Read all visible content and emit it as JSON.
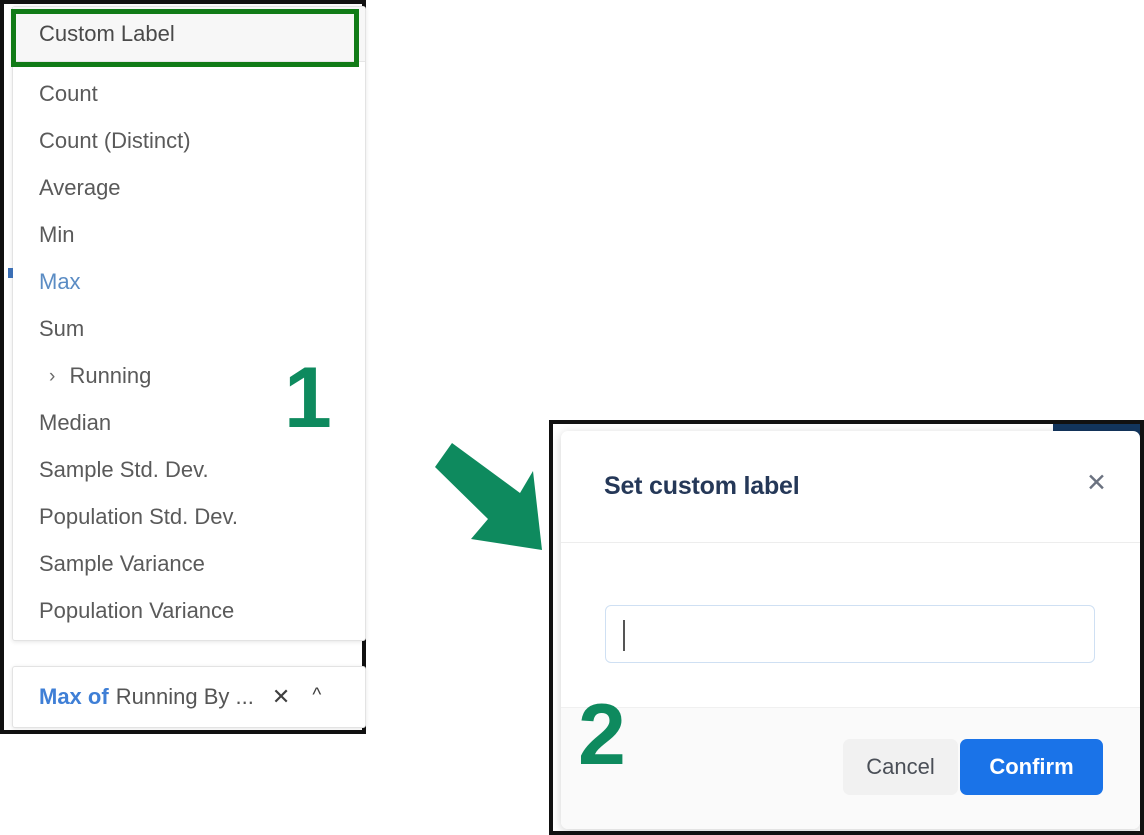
{
  "annotations": {
    "step_one": "1",
    "step_two": "2",
    "arrow_icon": "arrow-down-right-icon",
    "highlight_color": "#117b17",
    "annotation_color": "#0e8a5e"
  },
  "aggregation_menu": {
    "custom_label_row": "Custom Label",
    "items": [
      {
        "label": "Count",
        "selected": false,
        "sub": false
      },
      {
        "label": "Count (Distinct)",
        "selected": false,
        "sub": false
      },
      {
        "label": "Average",
        "selected": false,
        "sub": false
      },
      {
        "label": "Min",
        "selected": false,
        "sub": false
      },
      {
        "label": "Max",
        "selected": true,
        "sub": false
      },
      {
        "label": "Sum",
        "selected": false,
        "sub": false
      },
      {
        "label": "Running",
        "selected": false,
        "sub": true
      },
      {
        "label": "Median",
        "selected": false,
        "sub": false
      },
      {
        "label": "Sample Std. Dev.",
        "selected": false,
        "sub": false
      },
      {
        "label": "Population Std. Dev.",
        "selected": false,
        "sub": false
      },
      {
        "label": "Sample Variance",
        "selected": false,
        "sub": false
      },
      {
        "label": "Population Variance",
        "selected": false,
        "sub": false
      }
    ],
    "submenu_icon": "chevron-right-icon",
    "selected_color": "#5b8cc4"
  },
  "field_token": {
    "aggregation": "Max of",
    "field": "Running By ...",
    "remove_icon": "close-icon",
    "collapse_icon": "chevron-up-icon",
    "aggregation_color": "#3f7fd6"
  },
  "modal": {
    "title": "Set custom label",
    "close_icon": "close-icon",
    "input": {
      "value": "",
      "placeholder": ""
    },
    "cancel_label": "Cancel",
    "confirm_label": "Confirm",
    "confirm_color": "#1a73e8"
  }
}
